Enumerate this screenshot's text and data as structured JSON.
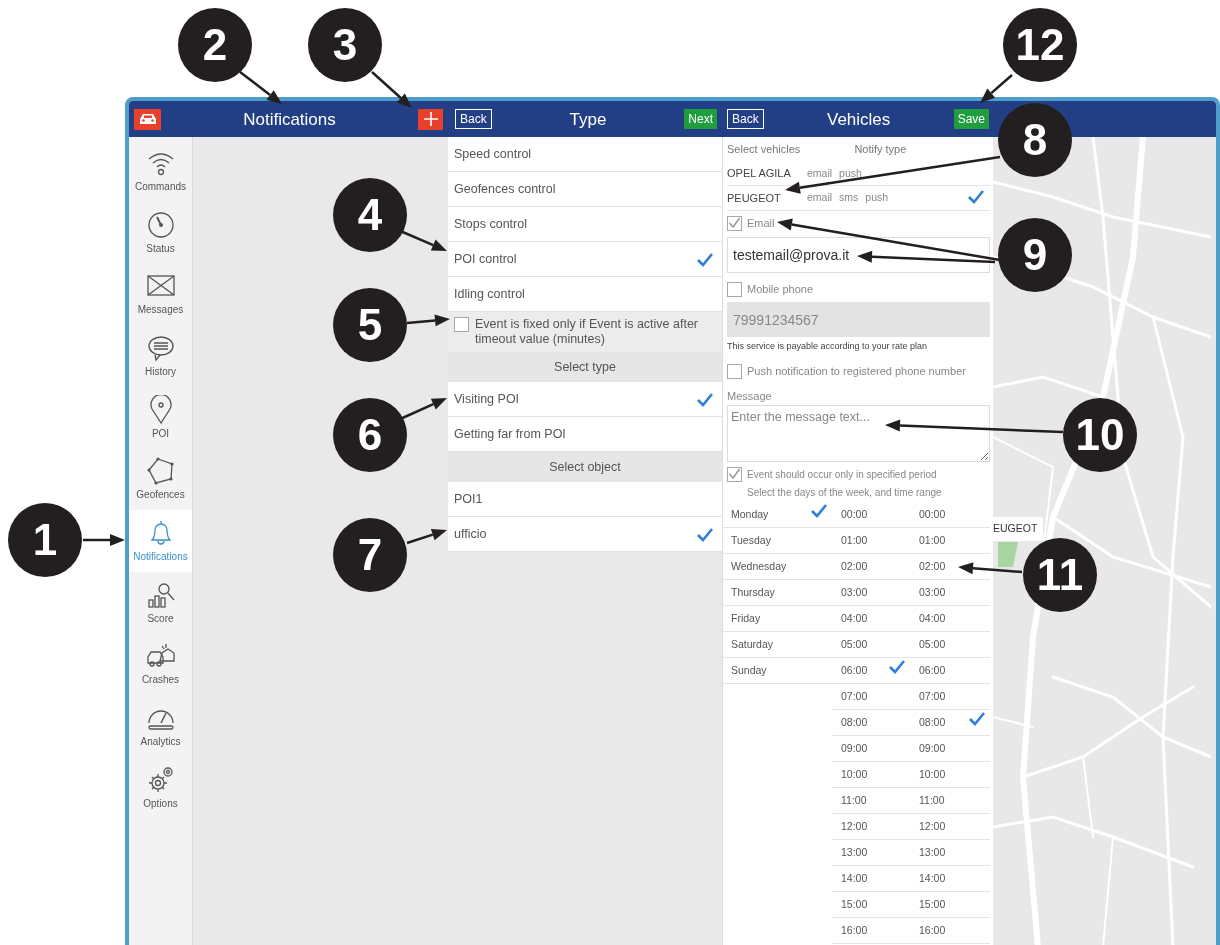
{
  "header": {
    "title": "Notifications"
  },
  "sidebar": {
    "items": [
      {
        "label": "Commands",
        "selected": false
      },
      {
        "label": "Status",
        "selected": false
      },
      {
        "label": "Messages",
        "selected": false
      },
      {
        "label": "History",
        "selected": false
      },
      {
        "label": "POI",
        "selected": false
      },
      {
        "label": "Geofences",
        "selected": false
      },
      {
        "label": "Notifications",
        "selected": true
      },
      {
        "label": "Score",
        "selected": false
      },
      {
        "label": "Crashes",
        "selected": false
      },
      {
        "label": "Analytics",
        "selected": false
      },
      {
        "label": "Options",
        "selected": false
      }
    ]
  },
  "type_panel": {
    "back": "Back",
    "title": "Type",
    "next": "Next",
    "types": [
      {
        "label": "Speed control",
        "selected": false
      },
      {
        "label": "Geofences control",
        "selected": false
      },
      {
        "label": "Stops control",
        "selected": false
      },
      {
        "label": "POI control",
        "selected": true
      },
      {
        "label": "Idling control",
        "selected": false
      }
    ],
    "timeout_option": {
      "label": "Event is fixed only if Event is active after timeout value (minutes)",
      "checked": false
    },
    "select_type_heading": "Select type",
    "event_types": [
      {
        "label": "Visiting POI",
        "selected": true
      },
      {
        "label": "Getting far from POI",
        "selected": false
      }
    ],
    "select_object_heading": "Select object",
    "objects": [
      {
        "label": "POI1",
        "selected": false
      },
      {
        "label": "ufficio",
        "selected": true
      }
    ]
  },
  "vehicles_panel": {
    "back": "Back",
    "title": "Vehicles",
    "save": "Save",
    "columns": [
      "Select vehicles",
      "Notify type"
    ],
    "vehicles": [
      {
        "name": "OPEL AGILA",
        "notify": [
          "email",
          "push"
        ],
        "selected": false
      },
      {
        "name": "PEUGEOT",
        "notify": [
          "email",
          "sms",
          "push"
        ],
        "selected": true
      }
    ],
    "email": {
      "label": "Email",
      "checked": true,
      "value": "testemail@prova.it"
    },
    "mobile": {
      "label": "Mobile phone",
      "checked": false,
      "value": "79991234567",
      "disabled": true
    },
    "note": "This service is payable according to your rate plan",
    "push": {
      "label": "Push notification to registered phone number",
      "checked": false
    },
    "message": {
      "label": "Message",
      "placeholder": "Enter the message text..."
    },
    "period": {
      "label": "Event should occur only in specified period",
      "checked": true,
      "hint": "Select the days of the week, and time range"
    },
    "days": [
      {
        "label": "Monday",
        "selected": true
      },
      {
        "label": "Tuesday",
        "selected": false
      },
      {
        "label": "Wednesday",
        "selected": false
      },
      {
        "label": "Thursday",
        "selected": false
      },
      {
        "label": "Friday",
        "selected": false
      },
      {
        "label": "Saturday",
        "selected": false
      },
      {
        "label": "Sunday",
        "selected": false
      }
    ],
    "start_times": [
      {
        "label": "00:00",
        "selected": false
      },
      {
        "label": "01:00",
        "selected": false
      },
      {
        "label": "02:00",
        "selected": false
      },
      {
        "label": "03:00",
        "selected": false
      },
      {
        "label": "04:00",
        "selected": false
      },
      {
        "label": "05:00",
        "selected": false
      },
      {
        "label": "06:00",
        "selected": true
      },
      {
        "label": "07:00",
        "selected": false
      },
      {
        "label": "08:00",
        "selected": false
      },
      {
        "label": "09:00",
        "selected": false
      },
      {
        "label": "10:00",
        "selected": false
      },
      {
        "label": "11:00",
        "selected": false
      },
      {
        "label": "12:00",
        "selected": false
      },
      {
        "label": "13:00",
        "selected": false
      },
      {
        "label": "14:00",
        "selected": false
      },
      {
        "label": "15:00",
        "selected": false
      },
      {
        "label": "16:00",
        "selected": false
      }
    ],
    "end_times": [
      {
        "label": "00:00",
        "selected": false
      },
      {
        "label": "01:00",
        "selected": false
      },
      {
        "label": "02:00",
        "selected": false
      },
      {
        "label": "03:00",
        "selected": false
      },
      {
        "label": "04:00",
        "selected": false
      },
      {
        "label": "05:00",
        "selected": false
      },
      {
        "label": "06:00",
        "selected": false
      },
      {
        "label": "07:00",
        "selected": false
      },
      {
        "label": "08:00",
        "selected": true
      },
      {
        "label": "09:00",
        "selected": false
      },
      {
        "label": "10:00",
        "selected": false
      },
      {
        "label": "11:00",
        "selected": false
      },
      {
        "label": "12:00",
        "selected": false
      },
      {
        "label": "13:00",
        "selected": false
      },
      {
        "label": "14:00",
        "selected": false
      },
      {
        "label": "15:00",
        "selected": false
      },
      {
        "label": "16:00",
        "selected": false
      }
    ]
  },
  "map": {
    "marker_label": "EUGEOT"
  },
  "callouts": [
    {
      "number": "2"
    },
    {
      "number": "3"
    },
    {
      "number": "12"
    },
    {
      "number": "8"
    },
    {
      "number": "4"
    },
    {
      "number": "9"
    },
    {
      "number": "5"
    },
    {
      "number": "6"
    },
    {
      "number": "10"
    },
    {
      "number": "1"
    },
    {
      "number": "7"
    },
    {
      "number": "11"
    }
  ]
}
